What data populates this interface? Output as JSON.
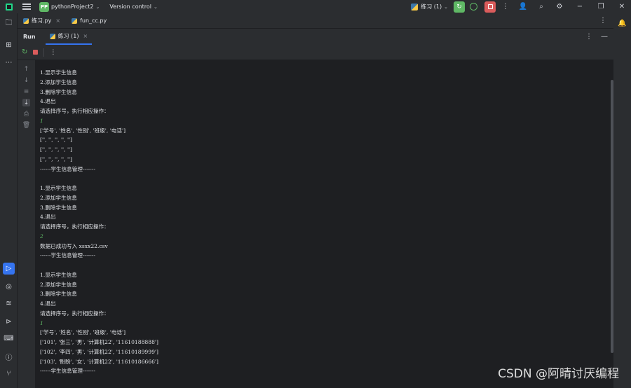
{
  "titlebar": {
    "project_badge": "PP",
    "project_name": "pythonProject2",
    "version_control": "Version control",
    "run_config": "练习 (1)"
  },
  "editor_tabs": [
    {
      "label": "练习.py"
    },
    {
      "label": "fun_cc.py"
    }
  ],
  "run_window": {
    "title": "Run",
    "tab_label": "练习 (1)"
  },
  "console": {
    "lines": [
      {
        "text": "1.显示学生信息",
        "type": "output"
      },
      {
        "text": "2.添加学生信息",
        "type": "output"
      },
      {
        "text": "3.删除学生信息",
        "type": "output"
      },
      {
        "text": "4.退出",
        "type": "output"
      },
      {
        "text": "请选择序号，执行相应操作：",
        "type": "output"
      },
      {
        "text": "1",
        "type": "input"
      },
      {
        "text": "['学号', '姓名', '性别', '班级', '电话']",
        "type": "output"
      },
      {
        "text": "['', '', '', '', '']",
        "type": "output"
      },
      {
        "text": "['', '', '', '', '']",
        "type": "output"
      },
      {
        "text": "['', '', '', '', '']",
        "type": "output"
      },
      {
        "text": "------学生信息管理-------",
        "type": "output"
      },
      {
        "text": "",
        "type": "output"
      },
      {
        "text": "1.显示学生信息",
        "type": "output"
      },
      {
        "text": "2.添加学生信息",
        "type": "output"
      },
      {
        "text": "3.删除学生信息",
        "type": "output"
      },
      {
        "text": "4.退出",
        "type": "output"
      },
      {
        "text": "请选择序号，执行相应操作：",
        "type": "output"
      },
      {
        "text": "2",
        "type": "input"
      },
      {
        "text": "数据已成功写入 xsxx22.csv",
        "type": "output"
      },
      {
        "text": "------学生信息管理-------",
        "type": "output"
      },
      {
        "text": "",
        "type": "output"
      },
      {
        "text": "1.显示学生信息",
        "type": "output"
      },
      {
        "text": "2.添加学生信息",
        "type": "output"
      },
      {
        "text": "3.删除学生信息",
        "type": "output"
      },
      {
        "text": "4.退出",
        "type": "output"
      },
      {
        "text": "请选择序号，执行相应操作：",
        "type": "output"
      },
      {
        "text": "1",
        "type": "input"
      },
      {
        "text": "['学号', '姓名', '性别', '班级', '电话']",
        "type": "output"
      },
      {
        "text": "['101', '张三', '男', '计算机22', '11610188888']",
        "type": "output"
      },
      {
        "text": "['102', '李四', '男', '计算机22', '11610189999']",
        "type": "output"
      },
      {
        "text": "['103', '盼盼', '女', '计算机22', '11610186666']",
        "type": "output"
      },
      {
        "text": "------学生信息管理-------",
        "type": "output"
      }
    ]
  },
  "watermark": "CSDN @阿晴讨厌编程",
  "colors": {
    "accent": "#3574f0",
    "run_green": "#5fb865",
    "stop_red": "#db5c5c",
    "background": "#1e1f22",
    "panel": "#2b2d30"
  }
}
